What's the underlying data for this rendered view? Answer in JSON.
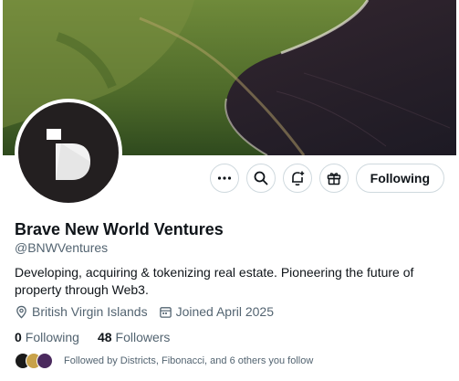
{
  "profile": {
    "name": "Brave New World Ventures",
    "handle": "@BNWVentures",
    "bio": "Developing, acquiring & tokenizing real estate. Pioneering the future of property through Web3.",
    "location": "British Virgin Islands",
    "joined": "Joined April 2025"
  },
  "stats": {
    "following_count": "0",
    "following_label": "Following",
    "followers_count": "48",
    "followers_label": "Followers"
  },
  "actions": {
    "more_icon": "more-horizontal-icon",
    "search_icon": "search-icon",
    "notify_icon": "bell-plus-icon",
    "subscribe_icon": "gift-icon",
    "follow_label": "Following"
  },
  "followed_by": {
    "text": "Followed by Districts, Fibonacci, and 6 others you follow",
    "avatar_colors": [
      "#1a1a1a",
      "#c8a24a",
      "#4b2a5e"
    ]
  },
  "colors": {
    "text_primary": "#0f1419",
    "text_secondary": "#536471",
    "border": "#cfd9de",
    "avatar_bg": "#231f20"
  }
}
